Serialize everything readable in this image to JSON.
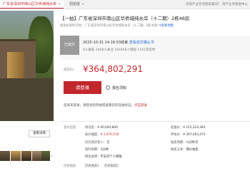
{
  "tabs": [
    {
      "label": "广东省深圳市南山区华侨城纯水岸",
      "close": "×"
    },
    {
      "label": "招拍挂",
      "close": "×"
    }
  ],
  "top_links": "对资产业务流程有疑问？ 资产业务帮助中心",
  "listing": {
    "title": "【一拍】广东省深圳市南山区华侨城纯水岸（十二期）2栋48房",
    "meta_prefix": "拍卖标的所在地：",
    "meta_address": "广东省深圳市南山区华侨城纯水岸（十二期）2栋48房",
    "meta_map": "查看地图"
  },
  "status": {
    "badge": "已成交",
    "date": "2025-10-31 14:16:53结束",
    "link": "查看成交确认书",
    "stats": "6人报名  1448人关注  193448人围观  1142次延时"
  },
  "price": {
    "label": "成交价：",
    "value": "¥364,802,291"
  },
  "actions": {
    "login": "请登录",
    "register_icon": "!",
    "register": "报名须知"
  },
  "notice": {
    "text": "您尚未登录，请登录后参拍或查看您的竞拍状态。",
    "link": "点击登录"
  },
  "street_view": "查看详情",
  "thumb_next": "›",
  "details": {
    "section_label": "竞价信息",
    "start_price_label": "保证金：",
    "start_price": "¥ 40,044,800",
    "increment_label": "加价幅度：",
    "increment": "¥ 1,076,150",
    "priority_label": "优先购买权人：",
    "priority": "无",
    "delay_label": "延时周期：",
    "delay": "5分钟",
    "note_label": "佣金说明：",
    "note": "不支持个人网银",
    "eval_label": "起拍价：",
    "eval": "¥ 215,224,381",
    "assess_label": "评估价：",
    "assess": "¥ 307,463,473",
    "cycle_label": "拍卖周期：",
    "cycle": "1分钟/次",
    "type_label": "拍卖方式：",
    "type": "增价拍卖"
  },
  "history": {
    "label": "历史拍卖",
    "item1": "历史拍卖1",
    "item2": "历史拍卖2"
  }
}
